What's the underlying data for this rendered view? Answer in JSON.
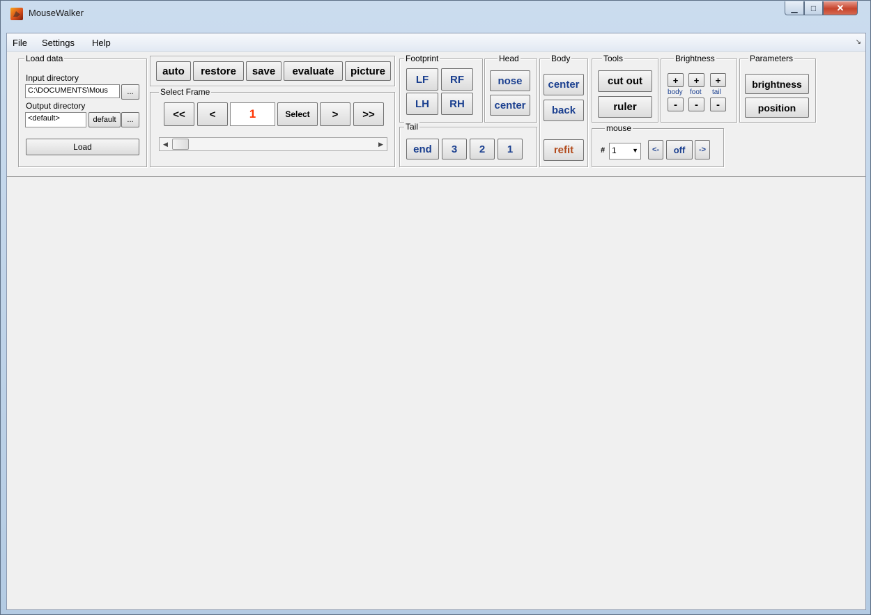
{
  "window": {
    "title": "MouseWalker"
  },
  "menu": {
    "items": [
      "File",
      "Settings",
      "Help"
    ]
  },
  "load_data": {
    "title": "Load data",
    "input_label": "Input directory",
    "input_value": "C:\\DOCUMENTS\\Mous",
    "browse_label": "...",
    "output_label": "Output directory",
    "output_value": "<default>",
    "default_label": "default",
    "load_label": "Load"
  },
  "actions": {
    "auto": "auto",
    "restore": "restore",
    "save": "save",
    "evaluate": "evaluate",
    "picture": "picture"
  },
  "select_frame": {
    "title": "Select Frame",
    "first": "<<",
    "prev": "<",
    "frame": "1",
    "select": "Select",
    "next": ">",
    "last": ">>",
    "slider_left": "◀",
    "slider_right": "▶"
  },
  "footprint": {
    "title": "Footprint",
    "lf": "LF",
    "rf": "RF",
    "lh": "LH",
    "rh": "RH"
  },
  "head": {
    "title": "Head",
    "nose": "nose",
    "center": "center"
  },
  "body_panel": {
    "title": "Body",
    "center": "center",
    "back": "back",
    "refit": "refit"
  },
  "tail": {
    "title": "Tail",
    "end": "end",
    "three": "3",
    "two": "2",
    "one": "1"
  },
  "tools": {
    "title": "Tools",
    "cut_out": "cut out",
    "ruler": "ruler"
  },
  "mouse": {
    "title": "mouse",
    "hash": "#",
    "selected": "1",
    "prev": "<-",
    "off": "off",
    "next": "->"
  },
  "brightness": {
    "title": "Brightness",
    "plus": "+",
    "minus": "-",
    "body": "body",
    "foot": "foot",
    "tail": "tail"
  },
  "parameters": {
    "title": "Parameters",
    "brightness": "brightness",
    "position": "position"
  },
  "colors": {
    "accent_blue": "#1a3f8f",
    "frame_red": "#ff3300",
    "refit_rust": "#b24a1b"
  }
}
